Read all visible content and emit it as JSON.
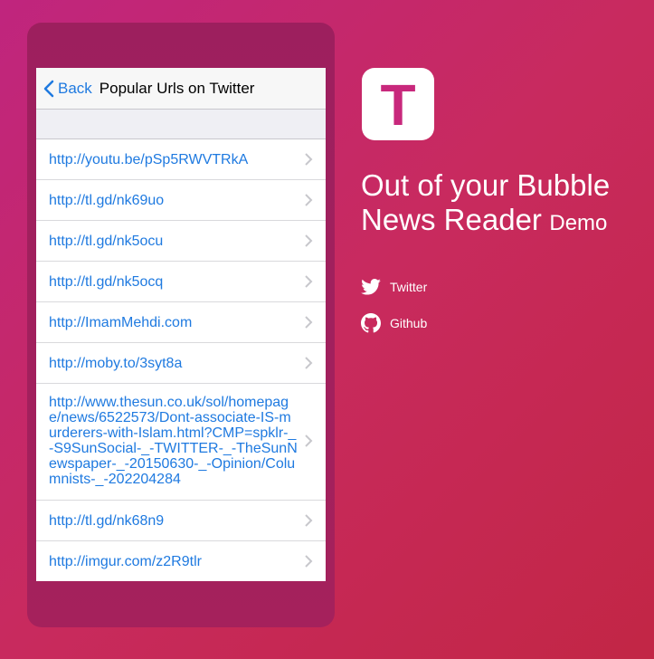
{
  "nav": {
    "back_label": "Back",
    "title": "Popular Urls on Twitter"
  },
  "urls": [
    "http://youtu.be/pSp5RWVTRkA",
    "http://tl.gd/nk69uo",
    "http://tl.gd/nk5ocu",
    "http://tl.gd/nk5ocq",
    "http://ImamMehdi.com",
    "http://moby.to/3syt8a",
    "http://www.thesun.co.uk/sol/homepage/news/6522573/Dont-associate-IS-murderers-with-Islam.html?CMP=spklr-_-S9SunSocial-_-TWITTER-_-TheSunNewspaper-_-20150630-_-Opinion/Columnists-_-202204284",
    "http://tl.gd/nk68n9",
    "http://imgur.com/z2R9tlr"
  ],
  "brand": {
    "logo_letter": "T",
    "title_line1": "Out of your Bubble",
    "title_line2": "News Reader",
    "title_suffix": "Demo"
  },
  "links": {
    "twitter_label": "Twitter",
    "github_label": "Github"
  },
  "colors": {
    "accent": "#c8287c",
    "link_blue": "#1f7ae0"
  }
}
